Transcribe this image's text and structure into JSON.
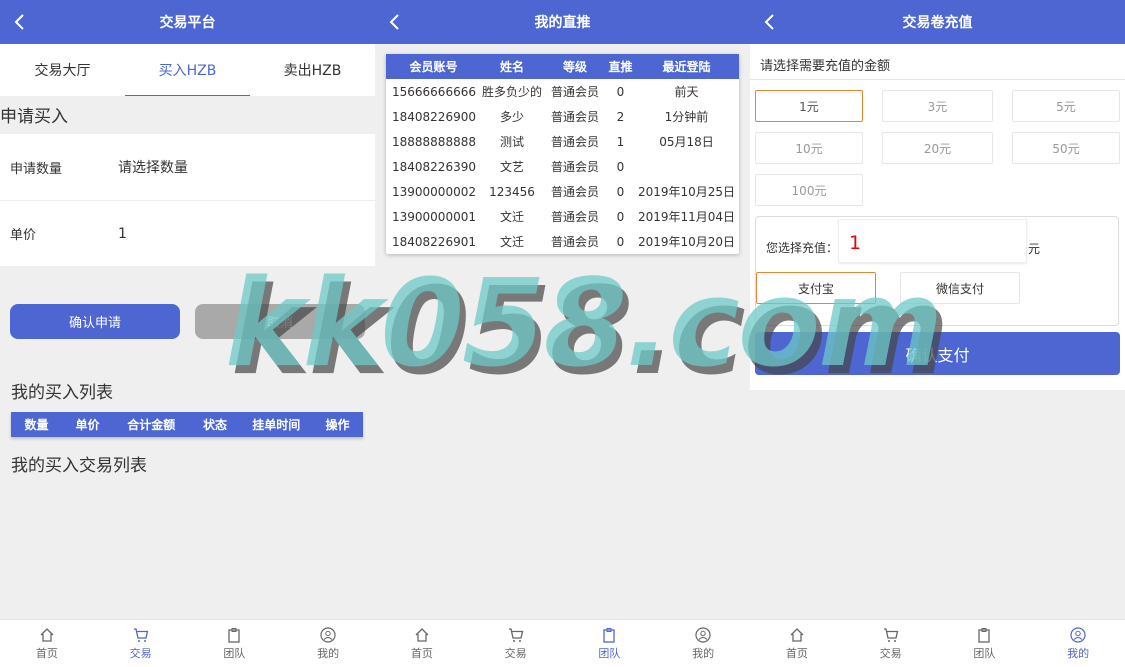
{
  "panel1": {
    "title": "交易平台",
    "tabs": [
      "交易大厅",
      "买入HZB",
      "卖出HZB"
    ],
    "apply_title": "申请买入",
    "qty_label": "申请数量",
    "qty_placeholder": "请选择数量",
    "price_label": "单价",
    "price_value": "1",
    "confirm_label": "确认申请",
    "cancel_label": "取消",
    "list_title": "我的买入列表",
    "list_columns": [
      "数量",
      "单价",
      "合计金额",
      "状态",
      "挂单时间",
      "操作"
    ],
    "trade_title": "我的买入交易列表"
  },
  "panel2": {
    "title": "我的直推",
    "columns": [
      "会员账号",
      "姓名",
      "等级",
      "直推",
      "最近登陆"
    ],
    "rows": [
      [
        "15666666666",
        "胜多负少的",
        "普通会员",
        "0",
        "前天"
      ],
      [
        "18408226900",
        "多少",
        "普通会员",
        "2",
        "1分钟前"
      ],
      [
        "18888888888",
        "测试",
        "普通会员",
        "1",
        "05月18日"
      ],
      [
        "18408226390",
        "文艺",
        "普通会员",
        "0",
        ""
      ],
      [
        "13900000002",
        "123456",
        "普通会员",
        "0",
        "2019年10月25日"
      ],
      [
        "13900000001",
        "文迁",
        "普通会员",
        "0",
        "2019年11月04日"
      ],
      [
        "18408226901",
        "文迁",
        "普通会员",
        "0",
        "2019年10月20日"
      ]
    ]
  },
  "panel3": {
    "title": "交易卷充值",
    "prompt": "请选择需要充值的金额",
    "amounts": [
      "1元",
      "3元",
      "5元",
      "10元",
      "20元",
      "50元",
      "100元"
    ],
    "selected_label": "您选择充值：",
    "selected_value": "1",
    "unit": "元",
    "pay_alipay": "支付宝",
    "pay_wechat": "微信支付",
    "confirm_label": "确认支付"
  },
  "nav": [
    "首页",
    "交易",
    "团队",
    "我的"
  ],
  "active_nav": {
    "panel1": 1,
    "panel2": 2,
    "panel3": 3
  },
  "watermark": "kk058.com",
  "colors": {
    "primary": "#4d66d2",
    "selected_border": "#e3862f",
    "price_red": "#e00000"
  }
}
